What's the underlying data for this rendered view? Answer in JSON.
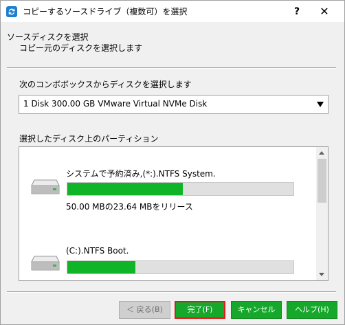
{
  "window": {
    "title": "コピーするソースドライブ（複数可）を選択",
    "help_glyph": "?",
    "close_glyph": "✕",
    "app_icon": "sync-arrows-icon"
  },
  "header": {
    "title": "ソースディスクを選択",
    "subtitle": "コピー元のディスクを選択します"
  },
  "disk_select": {
    "label": "次のコンボボックスからディスクを選択します",
    "selected": "1 Disk 300.00 GB VMware Virtual NVMe Disk"
  },
  "partitions": {
    "label": "選択したディスク上のパーティション",
    "items": [
      {
        "name": "システムで予約済み,(*:).NTFS System.",
        "used_fraction": 0.51,
        "info": "50.00 MBの23.64 MBをリリース"
      },
      {
        "name": "(C:).NTFS Boot.",
        "used_fraction": 0.3,
        "info": ""
      }
    ]
  },
  "buttons": {
    "back": "＜ 戻る(B)",
    "finish": "完了(F)",
    "cancel": "キャンセル",
    "help": "ヘルプ(H)"
  },
  "colors": {
    "accent_green": "#15a82a",
    "bar_fill": "#0fb526",
    "focus_border": "#e01b1b"
  }
}
